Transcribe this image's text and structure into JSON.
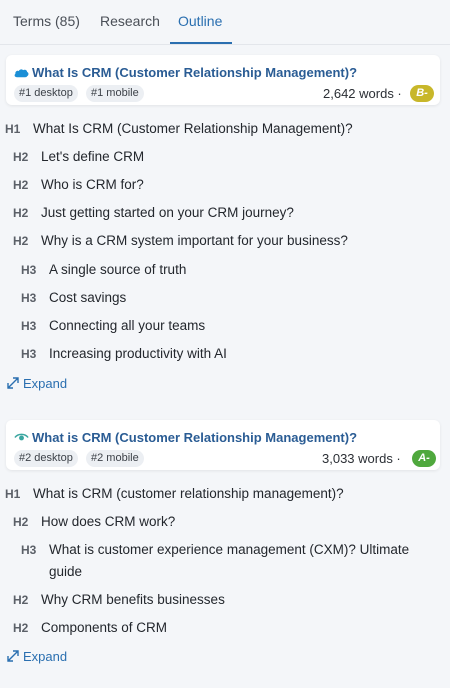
{
  "tabs": [
    {
      "label": "Terms (85)"
    },
    {
      "label": "Research"
    },
    {
      "label": "Outline"
    }
  ],
  "results": [
    {
      "title": "What Is CRM (Customer Relationship Management)?",
      "rank_desktop": "#1 desktop",
      "rank_mobile": "#1 mobile",
      "words": "2,642 words ·",
      "grade": "B-",
      "grade_color": "#c8b72a",
      "favicon": "salesforce-cloud-icon",
      "headings": [
        {
          "level": "H1",
          "text": "What Is CRM (Customer Relationship Management)?"
        },
        {
          "level": "H2",
          "text": "Let's define CRM"
        },
        {
          "level": "H2",
          "text": "Who is CRM for?"
        },
        {
          "level": "H2",
          "text": "Just getting started on your CRM journey?"
        },
        {
          "level": "H2",
          "text": "Why is a CRM system important for your business?"
        },
        {
          "level": "H3",
          "text": "A single source of truth"
        },
        {
          "level": "H3",
          "text": "Cost savings"
        },
        {
          "level": "H3",
          "text": "Connecting all your teams"
        },
        {
          "level": "H3",
          "text": "Increasing productivity with AI"
        }
      ],
      "expand_label": "Expand"
    },
    {
      "title": "What is CRM (Customer Relationship Management)?",
      "rank_desktop": "#2 desktop",
      "rank_mobile": "#2 mobile",
      "words": "3,033 words ·",
      "grade": "A-",
      "grade_color": "#4fa83d",
      "favicon": "eye-icon",
      "headings": [
        {
          "level": "H1",
          "text": "What is CRM (customer relationship management)?"
        },
        {
          "level": "H2",
          "text": "How does CRM work?"
        },
        {
          "level": "H3",
          "text": "What is customer experience management (CXM)? Ultimate"
        },
        {
          "level": "",
          "text": "guide"
        },
        {
          "level": "H2",
          "text": "Why CRM benefits businesses"
        },
        {
          "level": "H2",
          "text": "Components of CRM"
        }
      ],
      "expand_label": "Expand"
    }
  ]
}
